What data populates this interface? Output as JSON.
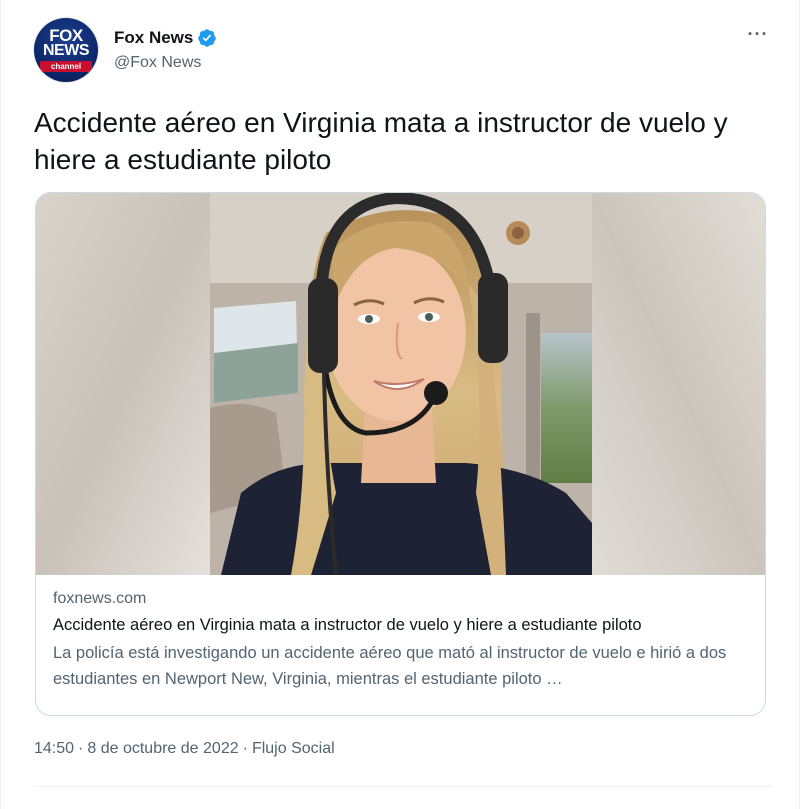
{
  "author": {
    "display_name": "Fox News",
    "handle": "@Fox News",
    "verified_icon": "verified-badge-icon",
    "avatar_text": {
      "line1": "FOX",
      "line2": "NEWS",
      "line3": "channel"
    },
    "avatar_color": "#0b2566",
    "verified_color": "#1d9bf0"
  },
  "more_label": "···",
  "tweet": {
    "text": "Accidente aéreo en Virginia mata a instructor de vuelo y hiere a estudiante piloto"
  },
  "card": {
    "image_icon": "pilot-photo",
    "domain": "foxnews.com",
    "title": "Accidente aéreo en Virginia mata a instructor de vuelo y hiere a estudiante piloto",
    "description": "La policía está investigando un accidente aéreo que mató al instructor de vuelo e hirió a dos estudiantes en Newport New, Virginia, mientras el estudiante piloto …"
  },
  "meta": {
    "time": "14:50",
    "date": "8 de octubre de 2022",
    "source": "Flujo Social"
  }
}
